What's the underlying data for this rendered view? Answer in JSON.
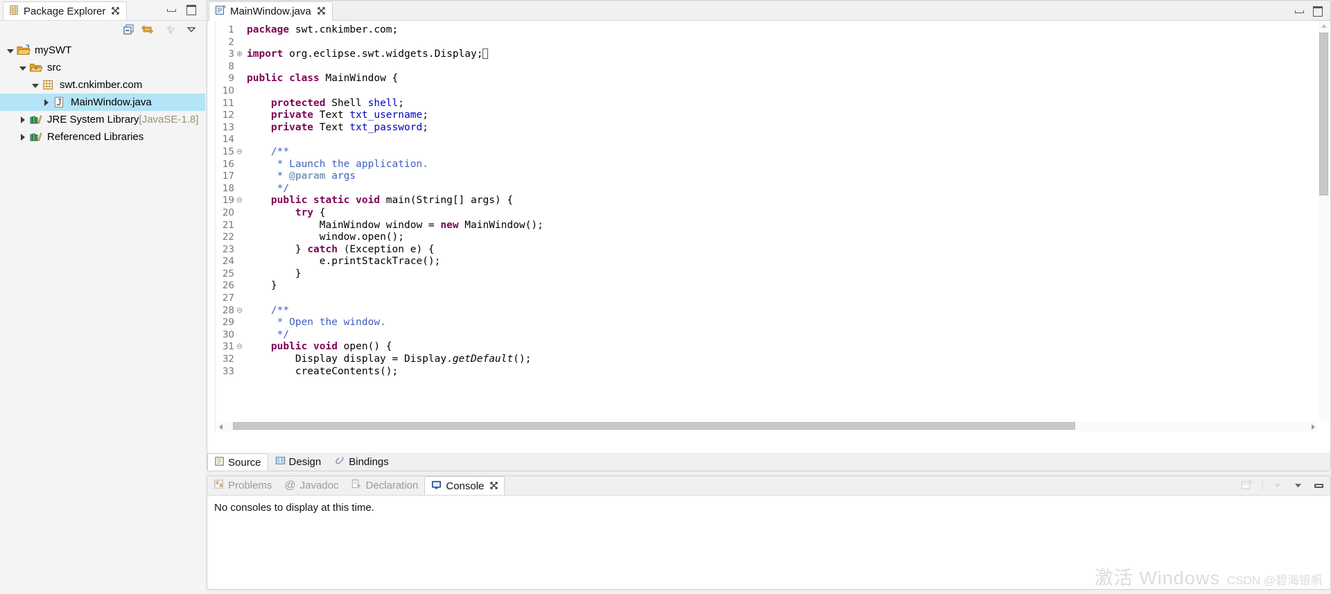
{
  "explorer": {
    "tab_label": "Package Explorer",
    "tab_close": "✕",
    "toolbar": [
      {
        "name": "collapse-all-icon",
        "title": "Collapse All"
      },
      {
        "name": "link-with-editor-icon",
        "title": "Link with Editor"
      },
      {
        "name": "focus-on-active-task-icon",
        "title": "Focus on Active Task"
      },
      {
        "name": "view-menu-icon",
        "title": "View Menu"
      }
    ],
    "tree": [
      {
        "label": "mySWT",
        "icon": "java-project-icon",
        "depth": 0,
        "expanded": true,
        "selected": false,
        "sub": ""
      },
      {
        "label": "src",
        "icon": "source-folder-icon",
        "depth": 1,
        "expanded": true,
        "selected": false,
        "sub": ""
      },
      {
        "label": "swt.cnkimber.com",
        "icon": "package-icon",
        "depth": 2,
        "expanded": true,
        "selected": false,
        "sub": ""
      },
      {
        "label": "MainWindow.java",
        "icon": "java-file-icon",
        "depth": 3,
        "expanded": false,
        "selected": true,
        "sub": ""
      },
      {
        "label": "JRE System Library ",
        "icon": "library-icon",
        "depth": 1,
        "expanded": false,
        "selected": false,
        "sub": "[JavaSE-1.8]"
      },
      {
        "label": "Referenced Libraries",
        "icon": "library-icon",
        "depth": 1,
        "expanded": false,
        "selected": false,
        "sub": ""
      }
    ]
  },
  "editor": {
    "tab_label": "MainWindow.java",
    "tab_close": "✕",
    "bottom_tabs": [
      {
        "label": "Source",
        "icon": "source-editor-icon",
        "active": true
      },
      {
        "label": "Design",
        "icon": "design-view-icon",
        "active": false
      },
      {
        "label": "Bindings",
        "icon": "bindings-icon",
        "active": false
      }
    ],
    "code": [
      {
        "n": "1",
        "fold": "",
        "indent": 0,
        "tokens": [
          {
            "t": "package",
            "c": "kw"
          },
          {
            "t": " swt.cnkimber.com;",
            "c": "plain"
          }
        ]
      },
      {
        "n": "2",
        "fold": "",
        "indent": 0,
        "tokens": []
      },
      {
        "n": "3",
        "fold": "⊕",
        "indent": 0,
        "tokens": [
          {
            "t": "import",
            "c": "kw"
          },
          {
            "t": " org.eclipse.swt.widgets.Display;",
            "c": "plain"
          },
          {
            "t": "▮",
            "c": "caret"
          }
        ]
      },
      {
        "n": "8",
        "fold": "",
        "indent": 0,
        "tokens": []
      },
      {
        "n": "9",
        "fold": "",
        "indent": 0,
        "tokens": [
          {
            "t": "public class",
            "c": "kw"
          },
          {
            "t": " MainWindow {",
            "c": "plain"
          }
        ]
      },
      {
        "n": "10",
        "fold": "",
        "indent": 0,
        "tokens": []
      },
      {
        "n": "11",
        "fold": "",
        "indent": 1,
        "tokens": [
          {
            "t": "protected",
            "c": "kw"
          },
          {
            "t": " Shell ",
            "c": "plain"
          },
          {
            "t": "shell",
            "c": "fld"
          },
          {
            "t": ";",
            "c": "plain"
          }
        ]
      },
      {
        "n": "12",
        "fold": "",
        "indent": 1,
        "tokens": [
          {
            "t": "private",
            "c": "kw"
          },
          {
            "t": " Text ",
            "c": "plain"
          },
          {
            "t": "txt_username",
            "c": "fld"
          },
          {
            "t": ";",
            "c": "plain"
          }
        ]
      },
      {
        "n": "13",
        "fold": "",
        "indent": 1,
        "tokens": [
          {
            "t": "private",
            "c": "kw"
          },
          {
            "t": " Text ",
            "c": "plain"
          },
          {
            "t": "txt_password",
            "c": "fld"
          },
          {
            "t": ";",
            "c": "plain"
          }
        ]
      },
      {
        "n": "14",
        "fold": "",
        "indent": 0,
        "tokens": []
      },
      {
        "n": "15",
        "fold": "⊖",
        "indent": 1,
        "tokens": [
          {
            "t": "/**",
            "c": "cmt"
          }
        ]
      },
      {
        "n": "16",
        "fold": "",
        "indent": 1,
        "tokens": [
          {
            "t": " * Launch the application.",
            "c": "cmt"
          }
        ]
      },
      {
        "n": "17",
        "fold": "",
        "indent": 1,
        "tokens": [
          {
            "t": " * ",
            "c": "cmt"
          },
          {
            "t": "@param",
            "c": "cmt-tag"
          },
          {
            "t": " args",
            "c": "cmt"
          }
        ]
      },
      {
        "n": "18",
        "fold": "",
        "indent": 1,
        "tokens": [
          {
            "t": " */",
            "c": "cmt"
          }
        ]
      },
      {
        "n": "19",
        "fold": "⊖",
        "indent": 1,
        "tokens": [
          {
            "t": "public static void",
            "c": "kw"
          },
          {
            "t": " main(String[] args) {",
            "c": "plain"
          }
        ]
      },
      {
        "n": "20",
        "fold": "",
        "indent": 2,
        "tokens": [
          {
            "t": "try",
            "c": "kw"
          },
          {
            "t": " {",
            "c": "plain"
          }
        ]
      },
      {
        "n": "21",
        "fold": "",
        "indent": 3,
        "tokens": [
          {
            "t": "MainWindow window = ",
            "c": "plain"
          },
          {
            "t": "new",
            "c": "kw"
          },
          {
            "t": " MainWindow();",
            "c": "plain"
          }
        ]
      },
      {
        "n": "22",
        "fold": "",
        "indent": 3,
        "tokens": [
          {
            "t": "window.open();",
            "c": "plain"
          }
        ]
      },
      {
        "n": "23",
        "fold": "",
        "indent": 2,
        "tokens": [
          {
            "t": "} ",
            "c": "plain"
          },
          {
            "t": "catch",
            "c": "kw"
          },
          {
            "t": " (Exception e) {",
            "c": "plain"
          }
        ]
      },
      {
        "n": "24",
        "fold": "",
        "indent": 3,
        "tokens": [
          {
            "t": "e.printStackTrace();",
            "c": "plain"
          }
        ]
      },
      {
        "n": "25",
        "fold": "",
        "indent": 2,
        "tokens": [
          {
            "t": "}",
            "c": "plain"
          }
        ]
      },
      {
        "n": "26",
        "fold": "",
        "indent": 1,
        "tokens": [
          {
            "t": "}",
            "c": "plain"
          }
        ]
      },
      {
        "n": "27",
        "fold": "",
        "indent": 0,
        "tokens": []
      },
      {
        "n": "28",
        "fold": "⊖",
        "indent": 1,
        "tokens": [
          {
            "t": "/**",
            "c": "cmt"
          }
        ]
      },
      {
        "n": "29",
        "fold": "",
        "indent": 1,
        "tokens": [
          {
            "t": " * Open the window.",
            "c": "cmt"
          }
        ]
      },
      {
        "n": "30",
        "fold": "",
        "indent": 1,
        "tokens": [
          {
            "t": " */",
            "c": "cmt"
          }
        ]
      },
      {
        "n": "31",
        "fold": "⊖",
        "indent": 1,
        "tokens": [
          {
            "t": "public void",
            "c": "kw"
          },
          {
            "t": " open() {",
            "c": "plain"
          }
        ]
      },
      {
        "n": "32",
        "fold": "",
        "indent": 2,
        "tokens": [
          {
            "t": "Display display = Display.",
            "c": "plain"
          },
          {
            "t": "getDefault",
            "c": "stat"
          },
          {
            "t": "();",
            "c": "plain"
          }
        ]
      },
      {
        "n": "33",
        "fold": "",
        "indent": 2,
        "tokens": [
          {
            "t": "createContents();",
            "c": "plain"
          }
        ]
      }
    ]
  },
  "console": {
    "tabs": [
      {
        "label": "Problems",
        "icon": "problems-icon",
        "active": false
      },
      {
        "label": "Javadoc",
        "icon": "javadoc-icon",
        "active": false
      },
      {
        "label": "Declaration",
        "icon": "declaration-icon",
        "active": false
      },
      {
        "label": "Console",
        "icon": "console-icon",
        "active": true
      }
    ],
    "tab_close": "✕",
    "message": "No consoles to display at this time.",
    "tools": [
      {
        "name": "open-console-icon"
      },
      {
        "name": "toolbar-separator"
      },
      {
        "name": "pin-console-dropdown-icon"
      },
      {
        "name": "view-menu-icon"
      },
      {
        "name": "minimize-icon"
      }
    ]
  },
  "watermark": {
    "activate": "激活 Windows",
    "credit": "CSDN @碧海银帆"
  },
  "colors": {
    "selection": "#b3e4f7",
    "keyword": "#7f0055",
    "comment": "#3f5fbf",
    "javadoc_tag": "#7f9fbf",
    "field": "#0000c0",
    "panel_bg": "#f0f0f0"
  }
}
